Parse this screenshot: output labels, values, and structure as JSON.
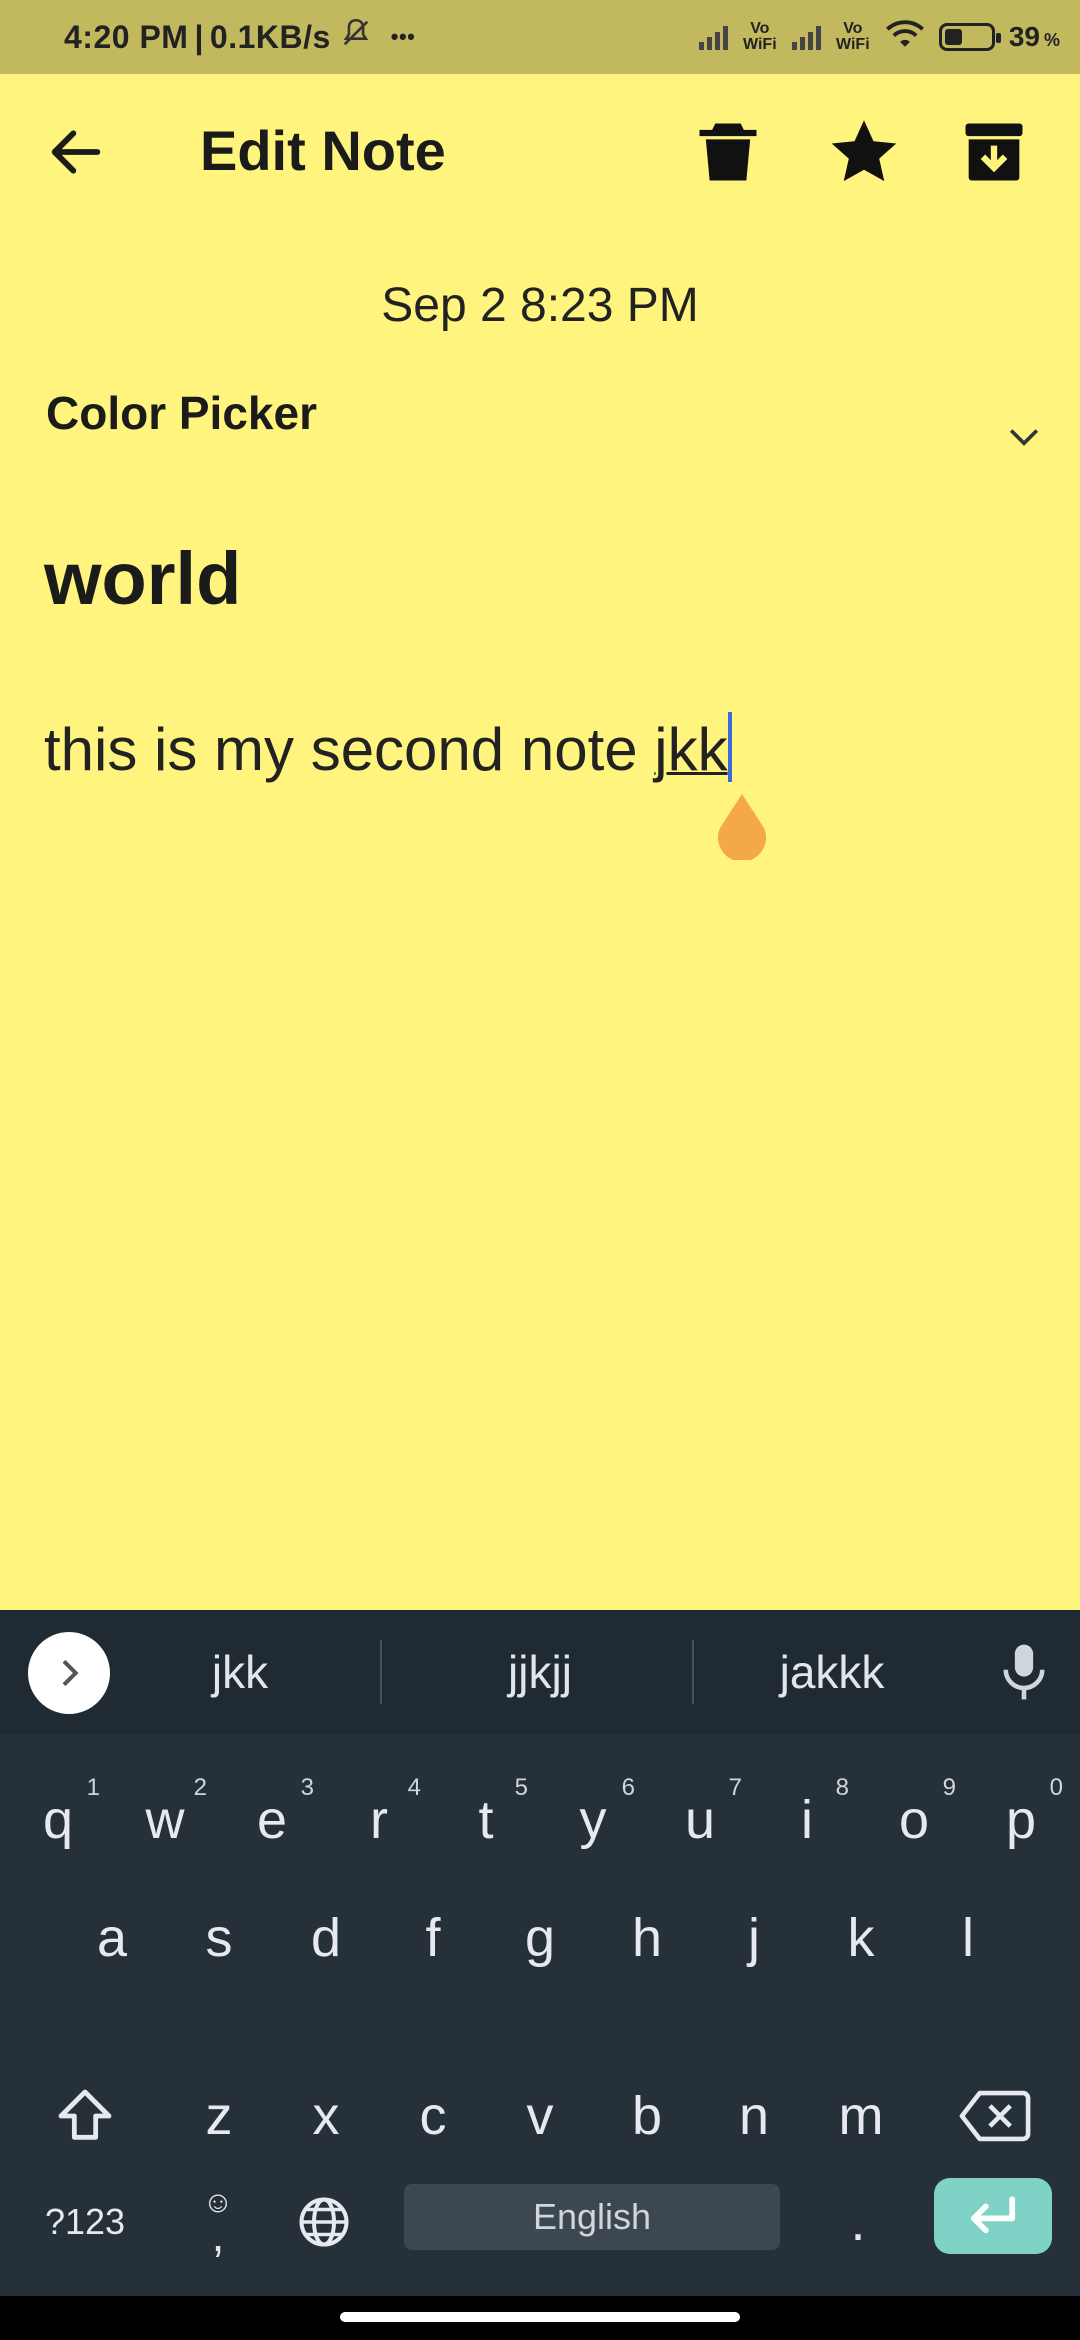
{
  "status_bar": {
    "time": "4:20 PM",
    "net_speed": "0.1KB/s",
    "more_dots": "•••",
    "sim1_label": "Vo WiFi",
    "sim2_label": "Vo WiFi",
    "battery_percent": "39",
    "battery_unit": "%",
    "battery_level": 0.39
  },
  "header": {
    "title": "Edit Note"
  },
  "note": {
    "date": "Sep 2 8:23 PM",
    "color_picker_label": "Color Picker",
    "title": "world",
    "body_plain": "this is my second note ",
    "body_composing": "jkk"
  },
  "colors": {
    "note_background": "#fff47d",
    "status_bar": "#c2b85e",
    "keyboard": "#253039",
    "enter_key": "#7fd3c6",
    "caret_handle": "#f5a84a"
  },
  "keyboard": {
    "suggestions": [
      "jkk",
      "jjkjj",
      "jakkk"
    ],
    "row1": [
      {
        "k": "q",
        "n": "1"
      },
      {
        "k": "w",
        "n": "2"
      },
      {
        "k": "e",
        "n": "3"
      },
      {
        "k": "r",
        "n": "4"
      },
      {
        "k": "t",
        "n": "5"
      },
      {
        "k": "y",
        "n": "6"
      },
      {
        "k": "u",
        "n": "7"
      },
      {
        "k": "i",
        "n": "8"
      },
      {
        "k": "o",
        "n": "9"
      },
      {
        "k": "p",
        "n": "0"
      }
    ],
    "row2": [
      "a",
      "s",
      "d",
      "f",
      "g",
      "h",
      "j",
      "k",
      "l"
    ],
    "row3": [
      "z",
      "x",
      "c",
      "v",
      "b",
      "n",
      "m"
    ],
    "symbols_label": "?123",
    "comma_label": ",",
    "period_label": ".",
    "space_label": "English"
  }
}
